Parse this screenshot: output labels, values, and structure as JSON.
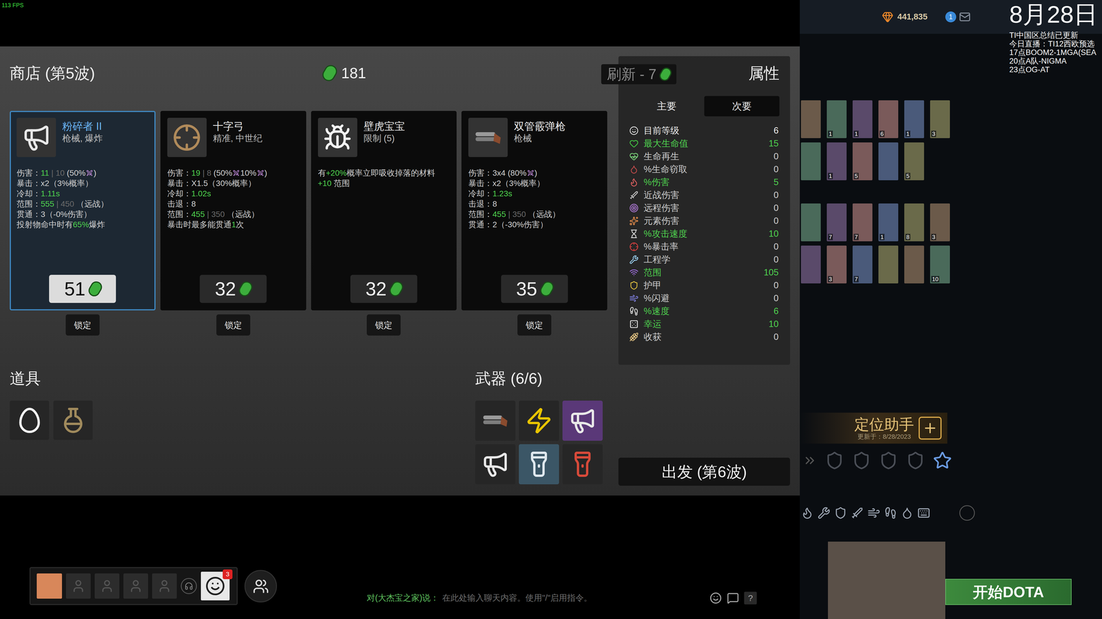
{
  "overlay": {
    "fps": "113 FPS"
  },
  "shop": {
    "title": "商店 (第5波)",
    "currency": "181",
    "refresh": "刷新 - 7",
    "cards": [
      {
        "kind": "megaphone",
        "selected": true,
        "name": "粉碎者 II",
        "tags": "枪械, 爆炸",
        "price": "51",
        "lock_label": "锁定",
        "lines": [
          [
            {
              "kind": "text",
              "text": "伤害：",
              "tone": "white"
            },
            {
              "kind": "text",
              "text": "11",
              "tone": "green"
            },
            {
              "kind": "text",
              "text": " | 10 ",
              "tone": "dim"
            },
            {
              "kind": "text",
              "text": "(50%",
              "tone": "white"
            },
            {
              "kind": "icon"
            },
            {
              "kind": "text",
              "text": ")",
              "tone": "white"
            }
          ],
          [
            {
              "kind": "text",
              "text": "暴击：x2（3%概率）",
              "tone": "white"
            }
          ],
          [
            {
              "kind": "text",
              "text": "冷却：",
              "tone": "white"
            },
            {
              "kind": "text",
              "text": "1.11s",
              "tone": "green"
            }
          ],
          [
            {
              "kind": "text",
              "text": "范围：",
              "tone": "white"
            },
            {
              "kind": "text",
              "text": "555",
              "tone": "green"
            },
            {
              "kind": "text",
              "text": " | 450 ",
              "tone": "dim"
            },
            {
              "kind": "text",
              "text": "（远战）",
              "tone": "white"
            }
          ],
          [
            {
              "kind": "text",
              "text": "贯通：3（-0%伤害）",
              "tone": "white"
            }
          ],
          [
            {
              "kind": "text",
              "text": "投射物命中时有",
              "tone": "white"
            },
            {
              "kind": "text",
              "text": "65%",
              "tone": "green"
            },
            {
              "kind": "text",
              "text": "爆炸",
              "tone": "white"
            }
          ]
        ]
      },
      {
        "kind": "crossbow",
        "selected": false,
        "name": "十字弓",
        "tags": "精准, 中世纪",
        "price": "32",
        "lock_label": "锁定",
        "lines": [
          [
            {
              "kind": "text",
              "text": "伤害：",
              "tone": "white"
            },
            {
              "kind": "text",
              "text": "19",
              "tone": "green"
            },
            {
              "kind": "text",
              "text": " | 8 ",
              "tone": "dim"
            },
            {
              "kind": "text",
              "text": "(50%",
              "tone": "white"
            },
            {
              "kind": "icon"
            },
            {
              "kind": "text",
              "text": "10%",
              "tone": "white"
            },
            {
              "kind": "icon"
            },
            {
              "kind": "text",
              "text": ")",
              "tone": "white"
            }
          ],
          [
            {
              "kind": "text",
              "text": "暴击：X1.5（30%概率）",
              "tone": "white"
            }
          ],
          [
            {
              "kind": "text",
              "text": "冷却：",
              "tone": "white"
            },
            {
              "kind": "text",
              "text": "1.02s",
              "tone": "green"
            }
          ],
          [
            {
              "kind": "text",
              "text": "击退：8",
              "tone": "white"
            }
          ],
          [
            {
              "kind": "text",
              "text": "范围：",
              "tone": "white"
            },
            {
              "kind": "text",
              "text": "455",
              "tone": "green"
            },
            {
              "kind": "text",
              "text": " | 350 ",
              "tone": "dim"
            },
            {
              "kind": "text",
              "text": "（远战）",
              "tone": "white"
            }
          ],
          [
            {
              "kind": "text",
              "text": "暴击时最多能贯通",
              "tone": "white"
            },
            {
              "kind": "text",
              "text": "1",
              "tone": "green"
            },
            {
              "kind": "text",
              "text": "次",
              "tone": "white"
            }
          ]
        ]
      },
      {
        "kind": "gecko",
        "selected": false,
        "name": "壁虎宝宝",
        "tags": "限制 (5)",
        "price": "32",
        "lock_label": "锁定",
        "lines": [
          [
            {
              "kind": "text",
              "text": "有",
              "tone": "white"
            },
            {
              "kind": "text",
              "text": "+20%",
              "tone": "green"
            },
            {
              "kind": "text",
              "text": "概率立即吸收掉落的材料",
              "tone": "white"
            }
          ],
          [
            {
              "kind": "text",
              "text": "+10",
              "tone": "green"
            },
            {
              "kind": "text",
              "text": " 范围",
              "tone": "white"
            }
          ]
        ]
      },
      {
        "kind": "shotgun",
        "selected": false,
        "name": "双管霰弹枪",
        "tags": "枪械",
        "price": "35",
        "lock_label": "锁定",
        "lines": [
          [
            {
              "kind": "text",
              "text": "伤害：3x4 (80%",
              "tone": "white"
            },
            {
              "kind": "icon"
            },
            {
              "kind": "text",
              "text": ")",
              "tone": "white"
            }
          ],
          [
            {
              "kind": "text",
              "text": "暴击：x2（3%概率）",
              "tone": "white"
            }
          ],
          [
            {
              "kind": "text",
              "text": "冷却：",
              "tone": "white"
            },
            {
              "kind": "text",
              "text": "1.23s",
              "tone": "green"
            }
          ],
          [
            {
              "kind": "text",
              "text": "击退：8",
              "tone": "white"
            }
          ],
          [
            {
              "kind": "text",
              "text": "范围：",
              "tone": "white"
            },
            {
              "kind": "text",
              "text": "455",
              "tone": "green"
            },
            {
              "kind": "text",
              "text": " | 350 ",
              "tone": "dim"
            },
            {
              "kind": "text",
              "text": "（远战）",
              "tone": "white"
            }
          ],
          [
            {
              "kind": "text",
              "text": "贯通：2（-30%伤害）",
              "tone": "white"
            }
          ]
        ]
      }
    ]
  },
  "items_section": {
    "title": "道具",
    "items": [
      {
        "kind": "egg"
      },
      {
        "kind": "potion"
      }
    ]
  },
  "weapons_section": {
    "title": "武器 (6/6)",
    "weapons": [
      {
        "kind": "shotgun",
        "color": "#262626"
      },
      {
        "kind": "taser",
        "color": "#262626"
      },
      {
        "kind": "megaphone",
        "color": "#5a3878"
      },
      {
        "kind": "megaphone",
        "color": "#262626"
      },
      {
        "kind": "blaster",
        "color": "#3b5666"
      },
      {
        "kind": "blaster-red",
        "color": "#262626"
      }
    ]
  },
  "stats": {
    "title": "属性",
    "tabs": [
      {
        "label": "主要",
        "selected": false
      },
      {
        "label": "次要",
        "selected": true
      }
    ],
    "rows": [
      {
        "label": "目前等级",
        "value": "6",
        "highlighted": false,
        "kind": "level"
      },
      {
        "label": "最大生命值",
        "value": "15",
        "highlighted": true,
        "kind": "stat"
      },
      {
        "label": "生命再生",
        "value": "0",
        "highlighted": false,
        "kind": "stat"
      },
      {
        "label": "%生命窃取",
        "value": "0",
        "highlighted": false,
        "kind": "stat"
      },
      {
        "label": "%伤害",
        "value": "5",
        "highlighted": true,
        "kind": "stat"
      },
      {
        "label": "近战伤害",
        "value": "0",
        "highlighted": false,
        "kind": "stat"
      },
      {
        "label": "远程伤害",
        "value": "0",
        "highlighted": false,
        "kind": "stat"
      },
      {
        "label": "元素伤害",
        "value": "0",
        "highlighted": false,
        "kind": "stat"
      },
      {
        "label": "%攻击速度",
        "value": "10",
        "highlighted": true,
        "kind": "stat"
      },
      {
        "label": "%暴击率",
        "value": "0",
        "highlighted": false,
        "kind": "stat"
      },
      {
        "label": "工程学",
        "value": "0",
        "highlighted": false,
        "kind": "stat"
      },
      {
        "label": "范围",
        "value": "105",
        "highlighted": true,
        "kind": "stat"
      },
      {
        "label": "护甲",
        "value": "0",
        "highlighted": false,
        "kind": "stat"
      },
      {
        "label": "%闪避",
        "value": "0",
        "highlighted": false,
        "kind": "stat"
      },
      {
        "label": "%速度",
        "value": "6",
        "highlighted": true,
        "kind": "stat"
      },
      {
        "label": "幸运",
        "value": "10",
        "highlighted": true,
        "kind": "stat"
      },
      {
        "label": "收获",
        "value": "0",
        "highlighted": false,
        "kind": "stat"
      }
    ]
  },
  "start_button": "出发 (第6波)",
  "client": {
    "shards": "441,835",
    "notification_count": "1",
    "date": "8月28日",
    "news": [
      "TI中国区总结已更新",
      "今日直播：TI12西欧预选",
      "17点BOOM2-1MGA(SEA",
      "20点A队-NIGMA",
      "23点OG-AT"
    ],
    "hero_groups": [
      {
        "rows": [
          [
            {
              "count": ""
            },
            {
              "count": "1"
            },
            {
              "count": "1"
            },
            {
              "count": "6"
            },
            {
              "count": "1"
            },
            {
              "count": "3"
            }
          ],
          [
            {
              "count": ""
            },
            {
              "count": "1"
            },
            {
              "count": "5"
            },
            {
              "count": ""
            },
            {
              "count": "5"
            }
          ]
        ]
      },
      {
        "rows": [
          [
            {
              "count": ""
            },
            {
              "count": "7"
            },
            {
              "count": "7"
            },
            {
              "count": "1"
            },
            {
              "count": "8"
            },
            {
              "count": "3"
            }
          ],
          [
            {
              "count": ""
            },
            {
              "count": "3"
            },
            {
              "count": "7"
            },
            {
              "count": ""
            },
            {
              "count": ""
            },
            {
              "count": "10"
            }
          ]
        ]
      }
    ],
    "locator": {
      "title": "定位助手",
      "updated": "更新于：8/28/2023"
    },
    "play_button": "开始DOTA"
  },
  "chat": {
    "channel": "对(大杰宝之家)说：",
    "placeholder": "在此处输入聊天内容。使用\"/\"启用指令。",
    "party_badge": "3",
    "help": "?"
  }
}
